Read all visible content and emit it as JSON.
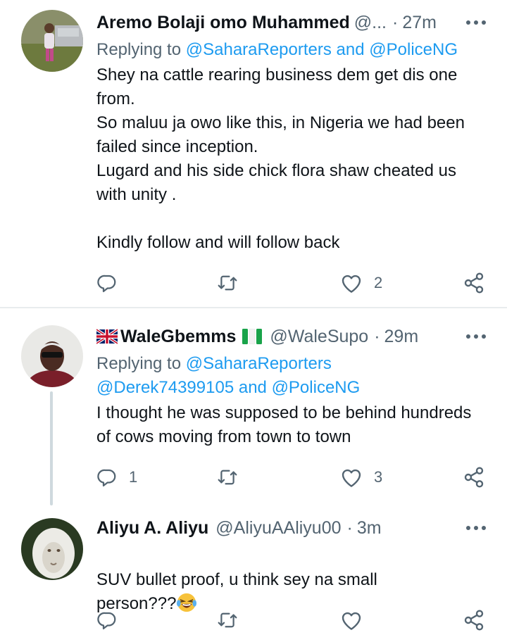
{
  "colors": {
    "accent": "#1d9bf0",
    "muted": "#536471",
    "text": "#0f1419",
    "divider": "#e8ecee",
    "thread": "#cfd9de"
  },
  "tweets": [
    {
      "display_name": "Aremo Bolaji omo Muhammed",
      "handle": "@...",
      "time": "27m",
      "replying_prefix": "Replying to ",
      "mention_1": "@SaharaReporters",
      "joiner_1": " and ",
      "mention_2": "@PoliceNG",
      "text": "Shey na cattle rearing business dem get  dis one from.\nSo maluu ja owo like this,  in Nigeria we had been failed since inception.\nLugard and his side chick flora shaw cheated us with unity .\n\nKindly follow and will follow back",
      "reply_count": "",
      "retweet_count": "",
      "like_count": "2"
    },
    {
      "display_name": "WaleGbemms",
      "handle": "@WaleSupo",
      "time": "29m",
      "replying_prefix": "Replying to ",
      "mention_1": "@SaharaReporters",
      "mention_2": "@Derek74399105",
      "joiner_2": " and ",
      "mention_3": "@PoliceNG",
      "text": "I thought he was supposed to be behind hundreds of cows moving from town to town",
      "reply_count": "1",
      "retweet_count": "",
      "like_count": "3"
    },
    {
      "display_name": "Aliyu A. Aliyu",
      "handle": "@AliyuAAliyu00",
      "time": "3m",
      "text": "SUV bullet proof, u think sey na small person???",
      "reply_count": "",
      "retweet_count": "",
      "like_count": ""
    }
  ],
  "separator": "·",
  "icons": [
    "reply-icon",
    "retweet-icon",
    "like-icon",
    "share-icon",
    "more-icon",
    "uk-flag-icon",
    "nigeria-flag-icon",
    "laughing-emoji-icon"
  ]
}
